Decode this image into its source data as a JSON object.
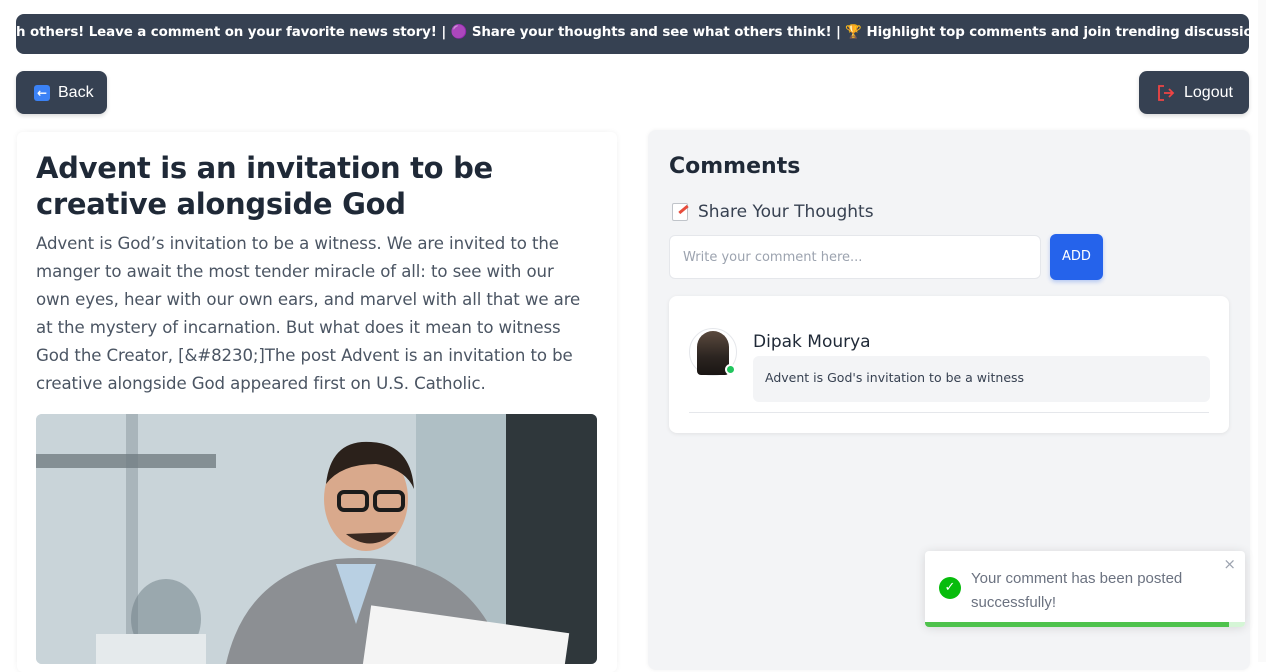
{
  "ticker": {
    "text": "h others! Leave a comment on your favorite news story! | 🟣 Share your thoughts and see what others think! | 🏆 Highlight top comments and join trending discussions! | 💖 React to comments"
  },
  "header": {
    "back_label": "Back",
    "back_icon": "left-arrow-icon",
    "logout_label": "Logout",
    "logout_icon": "logout-icon"
  },
  "article": {
    "title": "Advent is an invitation to be creative alongside God",
    "body": "Advent is God’s invitation to be a witness. We are invited to the manger to await the most tender miracle of all: to see with our own eyes, hear with our own ears, and marvel with all that we are at the mystery of incarnation. But what does it mean to witness God the Creator, [&#8230;]The post Advent is an invitation to be creative alongside God appeared first on U.S. Catholic."
  },
  "comments": {
    "title": "Comments",
    "share_label": "Share Your Thoughts",
    "input_placeholder": "Write your comment here...",
    "input_value": "",
    "add_label": "ADD",
    "items": [
      {
        "author": "Dipak Mourya",
        "text": "Advent is God's invitation to be a witness",
        "online": true
      }
    ]
  },
  "toast": {
    "message": "Your comment has been posted successfully!",
    "close_glyph": "×",
    "progress": 0.95,
    "type": "success"
  },
  "colors": {
    "dark": "#364152",
    "accent": "#2563eb",
    "success": "#07bc0c",
    "online": "#22c55e"
  }
}
